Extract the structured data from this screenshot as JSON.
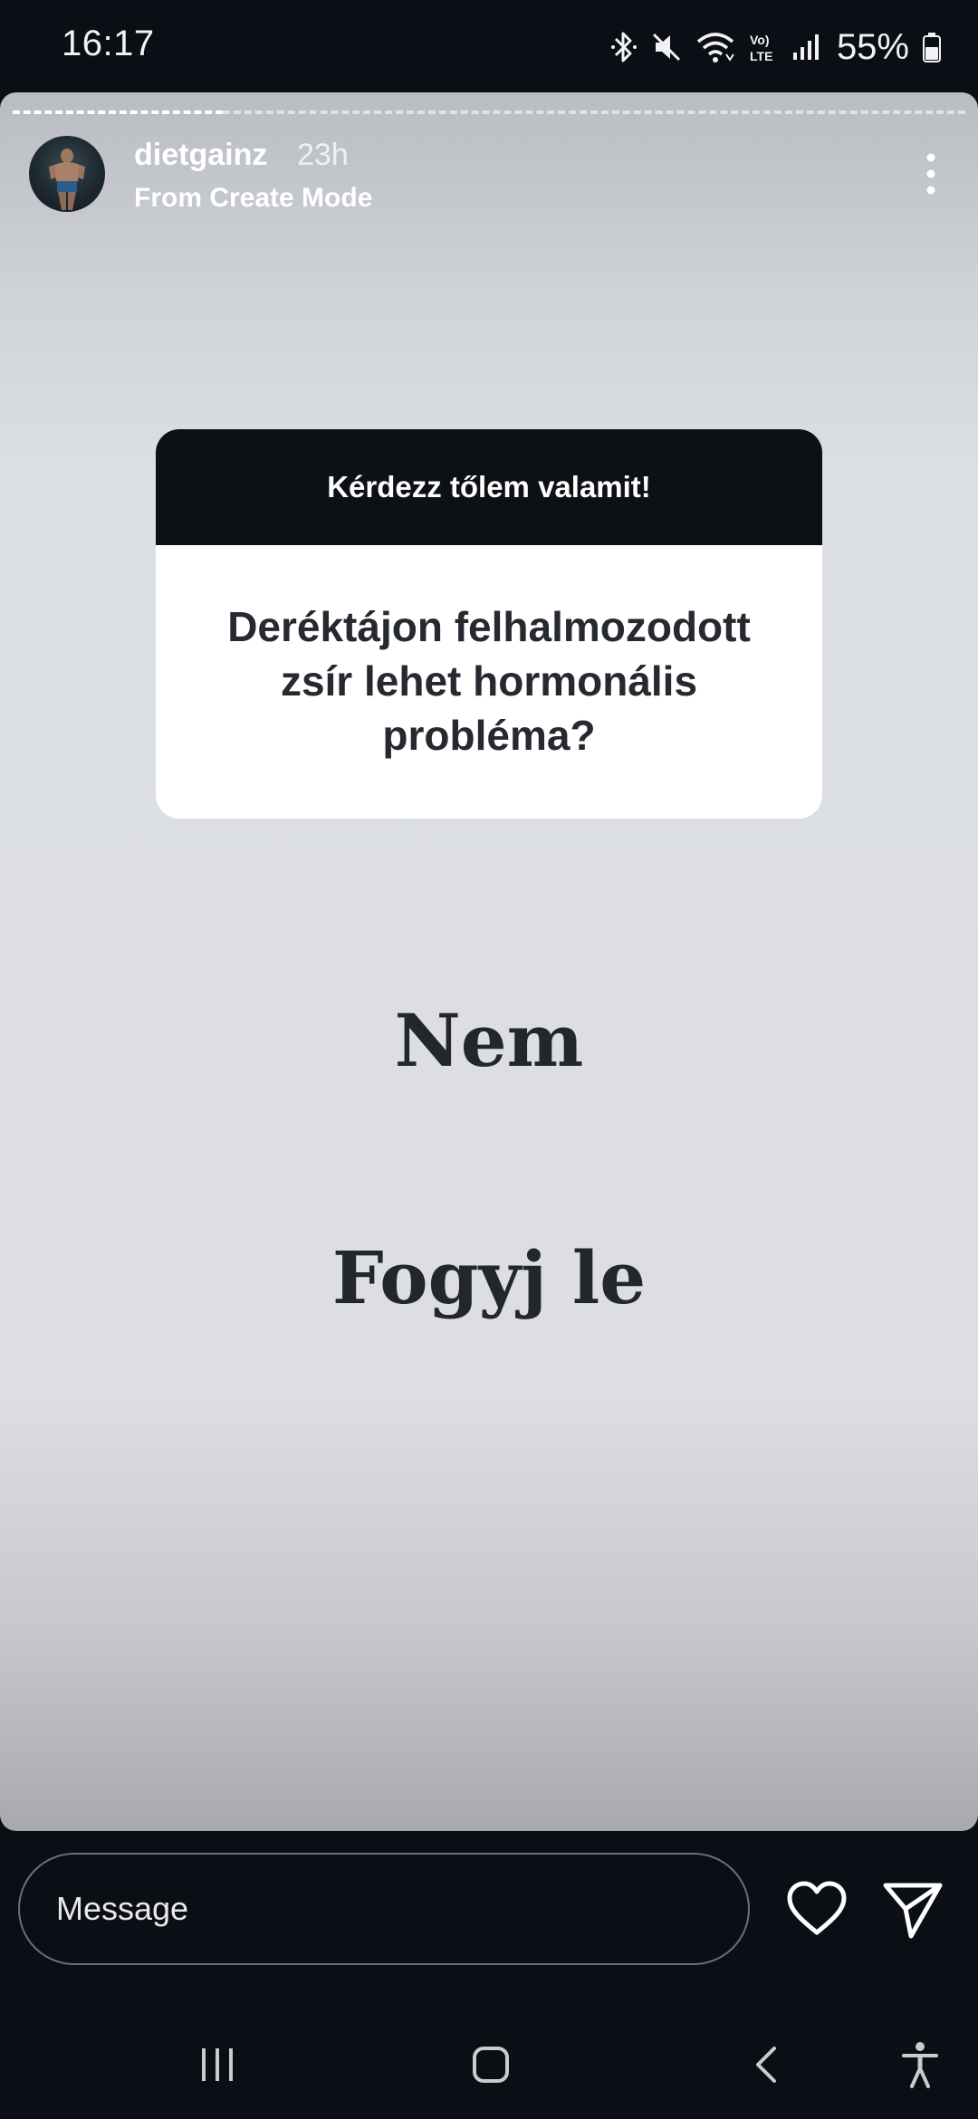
{
  "status_bar": {
    "time": "16:17",
    "battery": "55%",
    "icons": [
      "bluetooth-icon",
      "mute-icon",
      "wifi-icon",
      "volte-icon",
      "signal-icon",
      "battery-icon"
    ]
  },
  "story": {
    "username": "dietgainz",
    "time_ago": "23h",
    "subtitle": "From Create Mode",
    "question_header": "Kérdezz tőlem valamit!",
    "question": "Deréktájon felhalmozodott zsír lehet hormonális probléma?",
    "answer_line1": "Nem",
    "answer_line2": "Fogyj le"
  },
  "footer": {
    "message_placeholder": "Message"
  },
  "colors": {
    "background": "#0b0e14",
    "sticker_header": "#0d1015",
    "answer_text": "#23262b"
  }
}
